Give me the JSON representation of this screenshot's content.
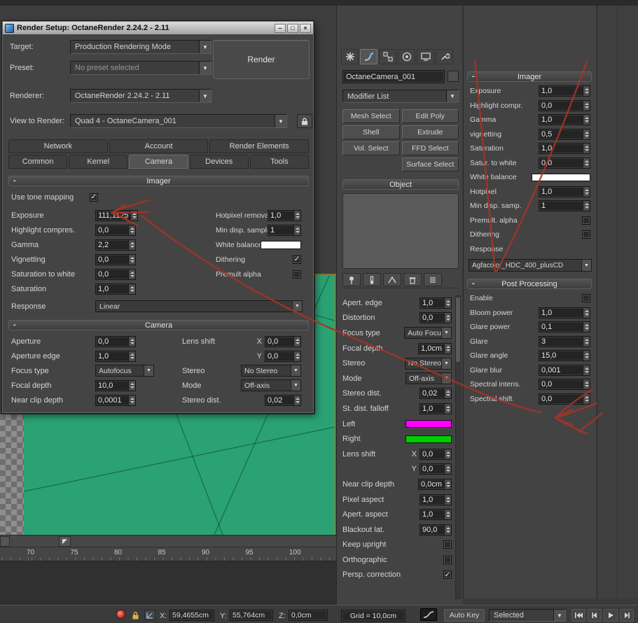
{
  "icons": {
    "minimize": "–",
    "maximize": "□",
    "close": "×",
    "chevron_down": "▼",
    "check": "✓",
    "viewport_corner": "◤",
    "collapse": "-"
  },
  "dialog": {
    "title": "Render Setup: OctaneRender 2.24.2 - 2.11",
    "target_label": "Target:",
    "target_value": "Production Rendering Mode",
    "preset_label": "Preset:",
    "preset_value": "No preset selected",
    "renderer_label": "Renderer:",
    "renderer_value": "OctaneRender 2.24.2 - 2.11",
    "view_label": "View to Render:",
    "view_value": "Quad 4 - OctaneCamera_001",
    "render_button": "Render",
    "tabs_row1": [
      {
        "label": "Network"
      },
      {
        "label": "Account"
      },
      {
        "label": "Render Elements"
      }
    ],
    "tabs_row2": [
      {
        "label": "Common"
      },
      {
        "label": "Kernel"
      },
      {
        "label": "Camera",
        "active": true
      },
      {
        "label": "Devices"
      },
      {
        "label": "Tools"
      }
    ],
    "imager_title": "Imager",
    "tone_mapping_label": "Use tone mapping",
    "tone_mapping_checked": true,
    "imager_left": [
      {
        "label": "Exposure",
        "type": "spin",
        "value": "111,1125"
      },
      {
        "label": "Highlight compres.",
        "type": "spin",
        "value": "0,0"
      },
      {
        "label": "Gamma",
        "type": "spin",
        "value": "2,2"
      },
      {
        "label": "Vignetting",
        "type": "spin",
        "value": "0,0"
      },
      {
        "label": "Saturation to white",
        "type": "spin",
        "value": "0,0"
      },
      {
        "label": "Saturation",
        "type": "spin",
        "value": "1,0"
      }
    ],
    "imager_right": [
      {
        "label": "Hotpixel removal",
        "type": "spin",
        "value": "1,0"
      },
      {
        "label": "Min disp. samples",
        "type": "spin",
        "value": "1"
      },
      {
        "label": "White balance",
        "type": "color",
        "color": "#ffffff"
      },
      {
        "label": "Dithering",
        "type": "check",
        "checked": true
      },
      {
        "label": "Premult alpha",
        "type": "check",
        "checked": false
      }
    ],
    "response_label": "Response",
    "response_value": "Linear",
    "camera_title": "Camera",
    "camera_left": [
      {
        "label": "Aperture",
        "type": "spin",
        "value": "0,0"
      },
      {
        "label": "Aperture edge",
        "type": "spin",
        "value": "1,0"
      },
      {
        "label": "Focus type",
        "type": "drop",
        "value": "Autofocus"
      },
      {
        "label": "Focal depth",
        "type": "spin",
        "value": "10,0"
      },
      {
        "label": "Near clip depth",
        "type": "spin",
        "value": "0,0001"
      }
    ],
    "camera_right": [
      {
        "label": "Lens shift",
        "sub": "X",
        "type": "spin",
        "value": "0,0"
      },
      {
        "label": "",
        "sub": "Y",
        "type": "spin",
        "value": "0,0"
      },
      {
        "label": "Stereo",
        "type": "drop",
        "value": "No Stereo"
      },
      {
        "label": "Mode",
        "type": "drop",
        "value": "Off-axis"
      },
      {
        "label": "Stereo dist.",
        "type": "spin",
        "value": "0,02"
      }
    ]
  },
  "command_panel": {
    "tab_names": [
      "create",
      "modify",
      "hierarchy",
      "motion",
      "display",
      "utilities"
    ],
    "object_name": "OctaneCamera_001",
    "modifier_list": "Modifier List",
    "modifier_buttons": [
      "Mesh Select",
      "Edit Poly",
      "Shell",
      "Extrude",
      "Vol. Select",
      "FFD Select",
      "",
      "Surface Select"
    ],
    "stack_title": "Object",
    "params": [
      {
        "label": "Apert. edge",
        "type": "spin",
        "value": "1,0"
      },
      {
        "label": "Distortion",
        "type": "spin",
        "value": "0,0"
      },
      {
        "label": "Focus type",
        "type": "drop",
        "value": "Auto Focu"
      },
      {
        "label": "Focal depth",
        "type": "spin",
        "value": "1,0cm"
      },
      {
        "label": "Stereo",
        "type": "drop",
        "value": "No Stereo"
      },
      {
        "label": "Mode",
        "type": "drop",
        "value": "Off-axis"
      },
      {
        "label": "Stereo dist.",
        "type": "spin",
        "value": "0,02"
      },
      {
        "label": "St. dist. falloff",
        "type": "spin",
        "value": "1,0"
      },
      {
        "label": "Left",
        "type": "color",
        "color": "#ff00ff"
      },
      {
        "label": "Right",
        "type": "color",
        "color": "#00cc00"
      },
      {
        "label": "Lens shift",
        "sub": "X",
        "type": "spin",
        "value": "0,0"
      },
      {
        "label": "",
        "sub": "Y",
        "type": "spin",
        "value": "0,0"
      },
      {
        "label": "Near clip depth",
        "type": "spin",
        "value": "0,0cm"
      },
      {
        "label": "Pixel aspect",
        "type": "spin",
        "value": "1,0"
      },
      {
        "label": "Apert. aspect",
        "type": "spin",
        "value": "1,0"
      },
      {
        "label": "Blackout lat.",
        "type": "spin",
        "value": "90,0"
      },
      {
        "label": "Keep upright",
        "type": "check",
        "checked": false
      },
      {
        "label": "Orthographic",
        "type": "check",
        "checked": false
      },
      {
        "label": "Persp. correction",
        "type": "check",
        "checked": true
      }
    ]
  },
  "right_panel": {
    "imager_title": "Imager",
    "imager_rows": [
      {
        "label": "Exposure",
        "type": "spin",
        "value": "1,0"
      },
      {
        "label": "Highlight compr.",
        "type": "spin",
        "value": "0,0"
      },
      {
        "label": "Gamma",
        "type": "spin",
        "value": "1,0"
      },
      {
        "label": "vignetting",
        "type": "spin",
        "value": "0,5"
      },
      {
        "label": "Saturation",
        "type": "spin",
        "value": "1,0"
      },
      {
        "label": "Satur. to white",
        "type": "spin",
        "value": "0,0"
      },
      {
        "label": "White balance",
        "type": "color",
        "color": "#ffffff"
      },
      {
        "label": "Hotpixel",
        "type": "spin",
        "value": "1,0"
      },
      {
        "label": "Min disp. samp.",
        "type": "spin",
        "value": "1"
      },
      {
        "label": "Premult. alpha",
        "type": "check",
        "checked": false
      },
      {
        "label": "Dithering",
        "type": "check",
        "checked": false
      },
      {
        "label": "Response",
        "type": "label"
      }
    ],
    "response_value": "Agfacolor_HDC_400_plusCD",
    "post_title": "Post Processing",
    "post_rows": [
      {
        "label": "Enable",
        "type": "check",
        "checked": false
      },
      {
        "label": "Bloom power",
        "type": "spin",
        "value": "1,0"
      },
      {
        "label": "Glare power",
        "type": "spin",
        "value": "0,1"
      },
      {
        "label": "Glare",
        "type": "spin",
        "value": "3"
      },
      {
        "label": "Glare angle",
        "type": "spin",
        "value": "15,0"
      },
      {
        "label": "Glare blur",
        "type": "spin",
        "value": "0,001"
      },
      {
        "label": "Spectral intens.",
        "type": "spin",
        "value": "0,0"
      },
      {
        "label": "Spectral shift",
        "type": "spin",
        "value": "0,0"
      }
    ]
  },
  "ruler": {
    "ticks": [
      "70",
      "75",
      "80",
      "85",
      "90",
      "95",
      "100"
    ]
  },
  "status_bar": {
    "x_label": "X:",
    "x_value": "59,4655cm",
    "y_label": "Y:",
    "y_value": "55,764cm",
    "z_label": "Z:",
    "z_value": "0,0cm",
    "grid_label": "Grid = 10,0cm",
    "auto_key": "Auto Key",
    "selected": "Selected"
  },
  "colors": {
    "viewport_green": "#2aa273",
    "annotation_red": "#a93226",
    "swatch_left": "#ff00ff",
    "swatch_right": "#00cc00",
    "white_balance": "#ffffff"
  }
}
